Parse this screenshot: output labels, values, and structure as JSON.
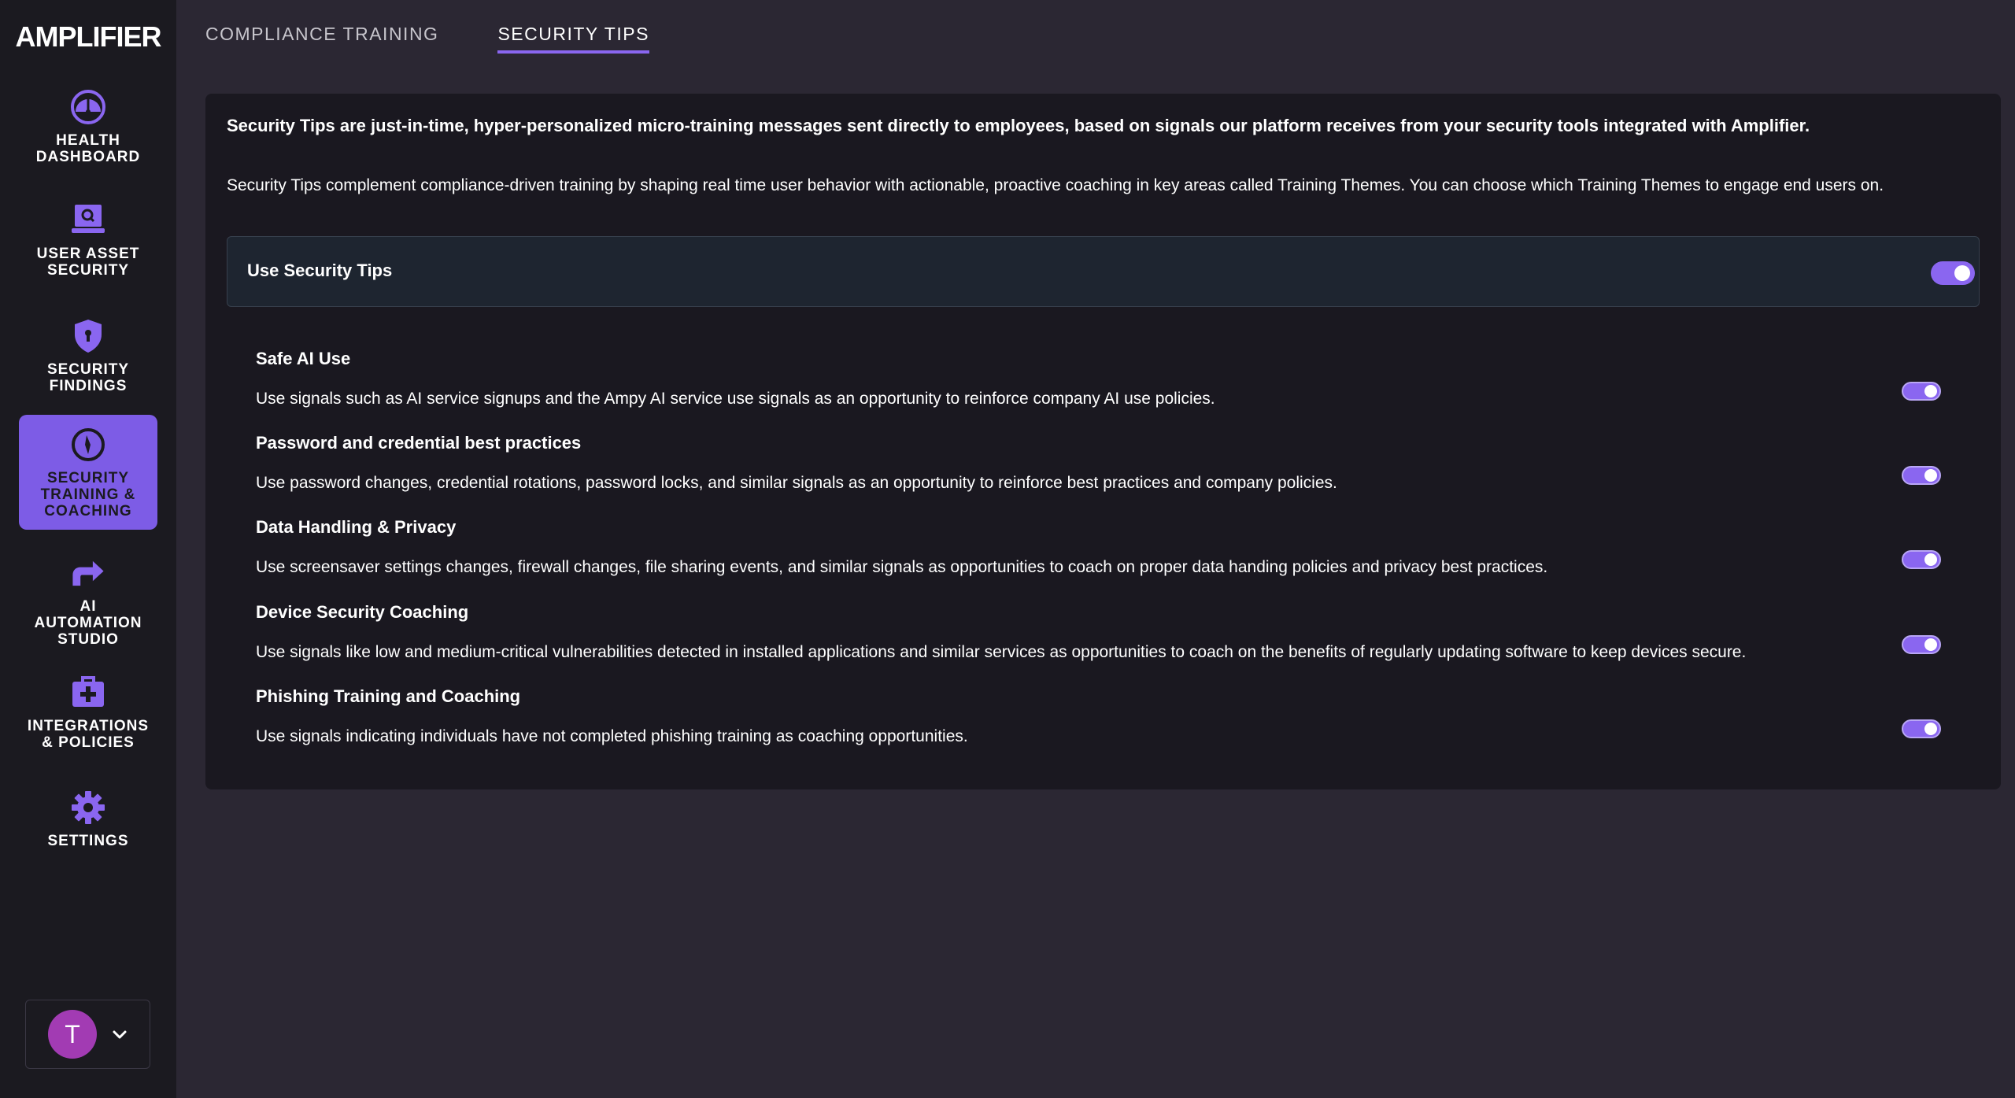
{
  "app": {
    "name": "AMPLIFIER"
  },
  "sidebar": {
    "items": [
      {
        "label": "HEALTH\nDASHBOARD",
        "icon": "gauge-icon"
      },
      {
        "label": "USER ASSET\nSECURITY",
        "icon": "laptop-search-icon"
      },
      {
        "label": "SECURITY\nFINDINGS",
        "icon": "shield-icon"
      },
      {
        "label": "SECURITY\nTRAINING &\nCOACHING",
        "icon": "compass-icon",
        "active": true
      },
      {
        "label": "AI\nAUTOMATION\nSTUDIO",
        "icon": "arrow-sign-icon"
      },
      {
        "label": "INTEGRATIONS\n& POLICIES",
        "icon": "medical-kit-icon"
      },
      {
        "label": "SETTINGS",
        "icon": "gear-icon"
      }
    ],
    "user": {
      "initial": "T"
    }
  },
  "tabs": [
    {
      "label": "COMPLIANCE TRAINING",
      "active": false
    },
    {
      "label": "SECURITY TIPS",
      "active": true
    }
  ],
  "content": {
    "intro_primary": "Security Tips are just-in-time, hyper-personalized micro-training messages sent directly to employees, based on signals our platform receives from your security tools integrated with Amplifier.",
    "intro_secondary": "Security Tips complement compliance-driven training by shaping real time user behavior with actionable, proactive coaching in key areas called Training Themes. You can choose which Training Themes to engage end users on.",
    "master_toggle": {
      "label": "Use Security Tips",
      "enabled": true
    },
    "themes": [
      {
        "title": "Safe AI Use",
        "description": "Use signals such as AI service signups and the Ampy AI service use signals as an opportunity to reinforce company AI use policies.",
        "enabled": true
      },
      {
        "title": "Password and credential best practices",
        "description": "Use password changes, credential rotations, password locks, and similar signals as an opportunity to reinforce best practices and company policies.",
        "enabled": true
      },
      {
        "title": "Data Handling & Privacy",
        "description": "Use screensaver settings changes, firewall changes, file sharing events, and similar signals as opportunities to coach on proper data handing policies and privacy best practices.",
        "enabled": true
      },
      {
        "title": "Device Security Coaching",
        "description": "Use signals like low and medium-critical vulnerabilities detected in installed applications and similar services as opportunities to coach on the benefits of regularly updating software to keep devices secure.",
        "enabled": true
      },
      {
        "title": "Phishing Training and Coaching",
        "description": "Use signals indicating individuals have not completed phishing training as coaching opportunities.",
        "enabled": true
      }
    ]
  },
  "colors": {
    "accent": "#8a66f0",
    "sidebar_active": "#7d5ce6",
    "avatar": "#a23bb3",
    "page_bg": "#2b2733",
    "card_bg": "#1a1820"
  }
}
